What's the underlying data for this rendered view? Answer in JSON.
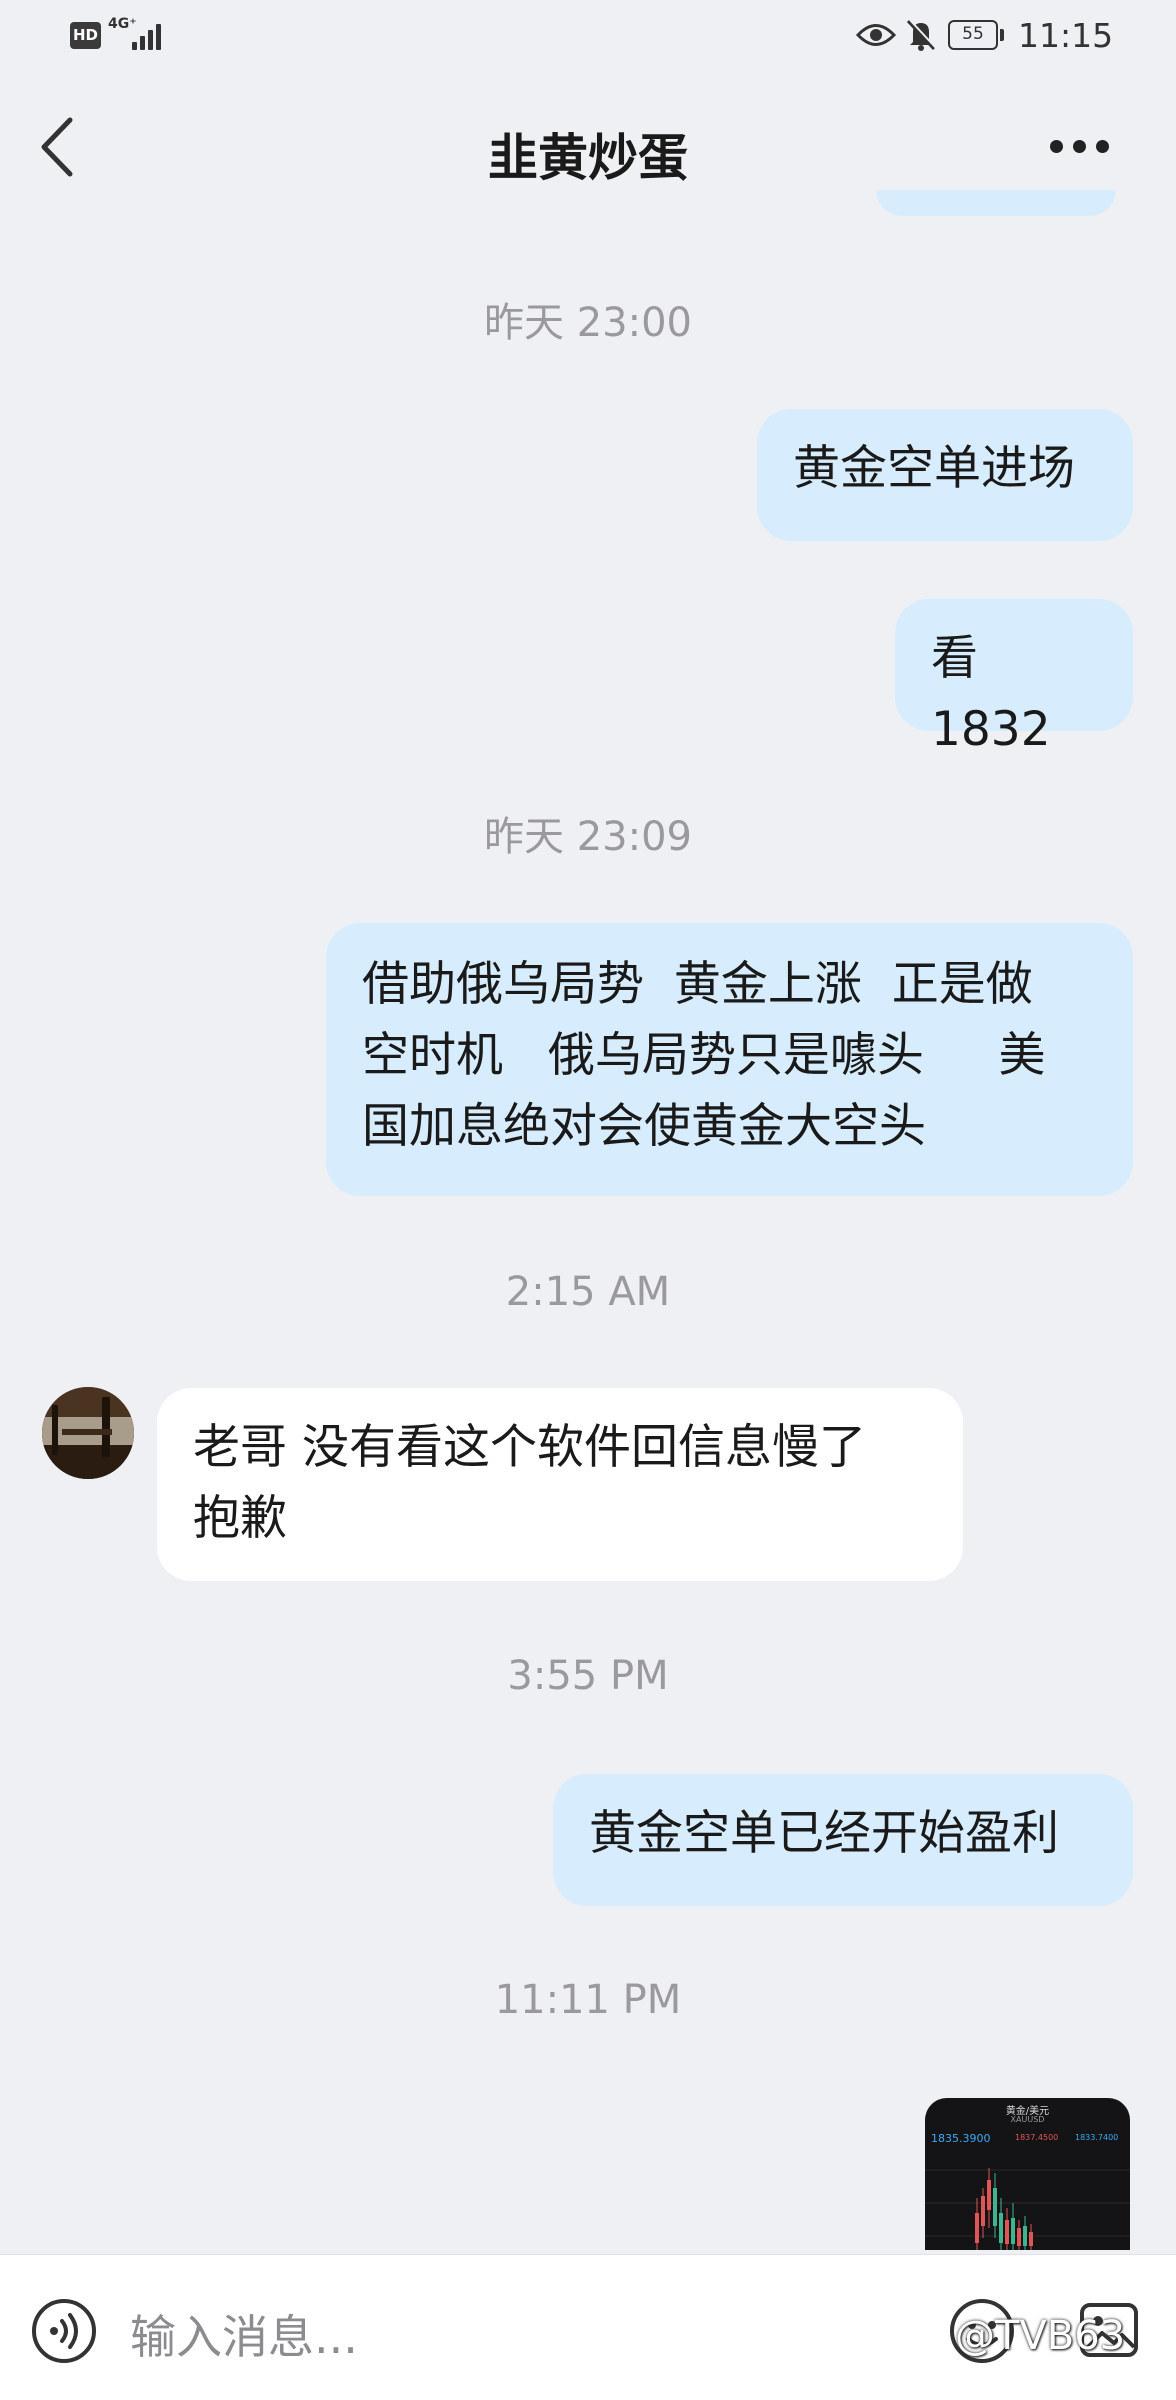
{
  "status_bar": {
    "hd_label": "HD",
    "network_label": "4G⁺",
    "battery_level": "55",
    "clock": "11:15",
    "icons": [
      "signal-icon",
      "eye-icon",
      "mute-bell-icon",
      "battery-icon"
    ]
  },
  "header": {
    "title": "韭黄炒蛋",
    "icons": [
      "back-icon",
      "more-icon"
    ]
  },
  "chat": {
    "timestamps": [
      "昨天 23:00",
      "昨天 23:09",
      "2:15 AM",
      "3:55 PM",
      "11:11 PM"
    ],
    "messages": [
      {
        "direction": "out",
        "text": "黄金空单进场"
      },
      {
        "direction": "out",
        "text": "看1832"
      },
      {
        "direction": "out",
        "lines": [
          "借助俄乌局势  黄金上涨  正是做",
          "空时机   俄乌局势只是噱头     美",
          "国加息绝对会使黄金大空头"
        ]
      },
      {
        "direction": "in",
        "lines": [
          "老哥 没有看这个软件回信息慢了",
          "抱歉"
        ]
      },
      {
        "direction": "out",
        "text": "黄金空单已经开始盈利"
      }
    ],
    "image_message": {
      "title": "黄金/美元",
      "symbol": "XAUUSD",
      "price": "1835.3900",
      "high": "1837.4500",
      "low": "1833.7400"
    }
  },
  "input_bar": {
    "placeholder": "输入消息...",
    "watermark": "@TVB63",
    "icons": [
      "voice-icon",
      "emoji-icon",
      "image-icon"
    ]
  },
  "colors": {
    "background": "#eff0f3",
    "outgoing_bubble": "#d7ecfc",
    "incoming_bubble": "#ffffff",
    "timestamp": "#9a9a9e"
  }
}
